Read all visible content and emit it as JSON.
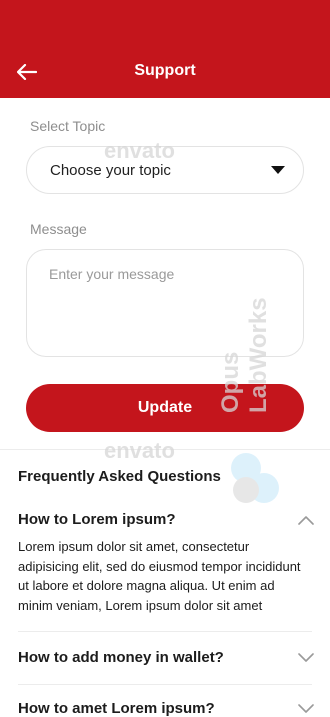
{
  "header": {
    "title": "Support",
    "back_icon": "arrow-left-icon",
    "color": "#c4151c"
  },
  "form": {
    "topic_label": "Select Topic",
    "topic_value": "Choose your topic",
    "message_label": "Message",
    "message_placeholder": "Enter your message",
    "update_label": "Update"
  },
  "faq": {
    "title": "Frequently Asked Questions",
    "items": [
      {
        "question": "How to Lorem ipsum?",
        "expanded": true,
        "answer": "Lorem ipsum dolor sit amet, consectetur adipisicing elit, sed do eiusmod tempor incididunt ut labore et dolore magna aliqua. Ut enim ad minim veniam, Lorem ipsum dolor sit amet"
      },
      {
        "question": "How to add money in wallet?",
        "expanded": false
      },
      {
        "question": "How to amet Lorem ipsum?",
        "expanded": false
      }
    ]
  },
  "watermarks": {
    "envato": "envato",
    "opus": "Opus LabWorks"
  }
}
